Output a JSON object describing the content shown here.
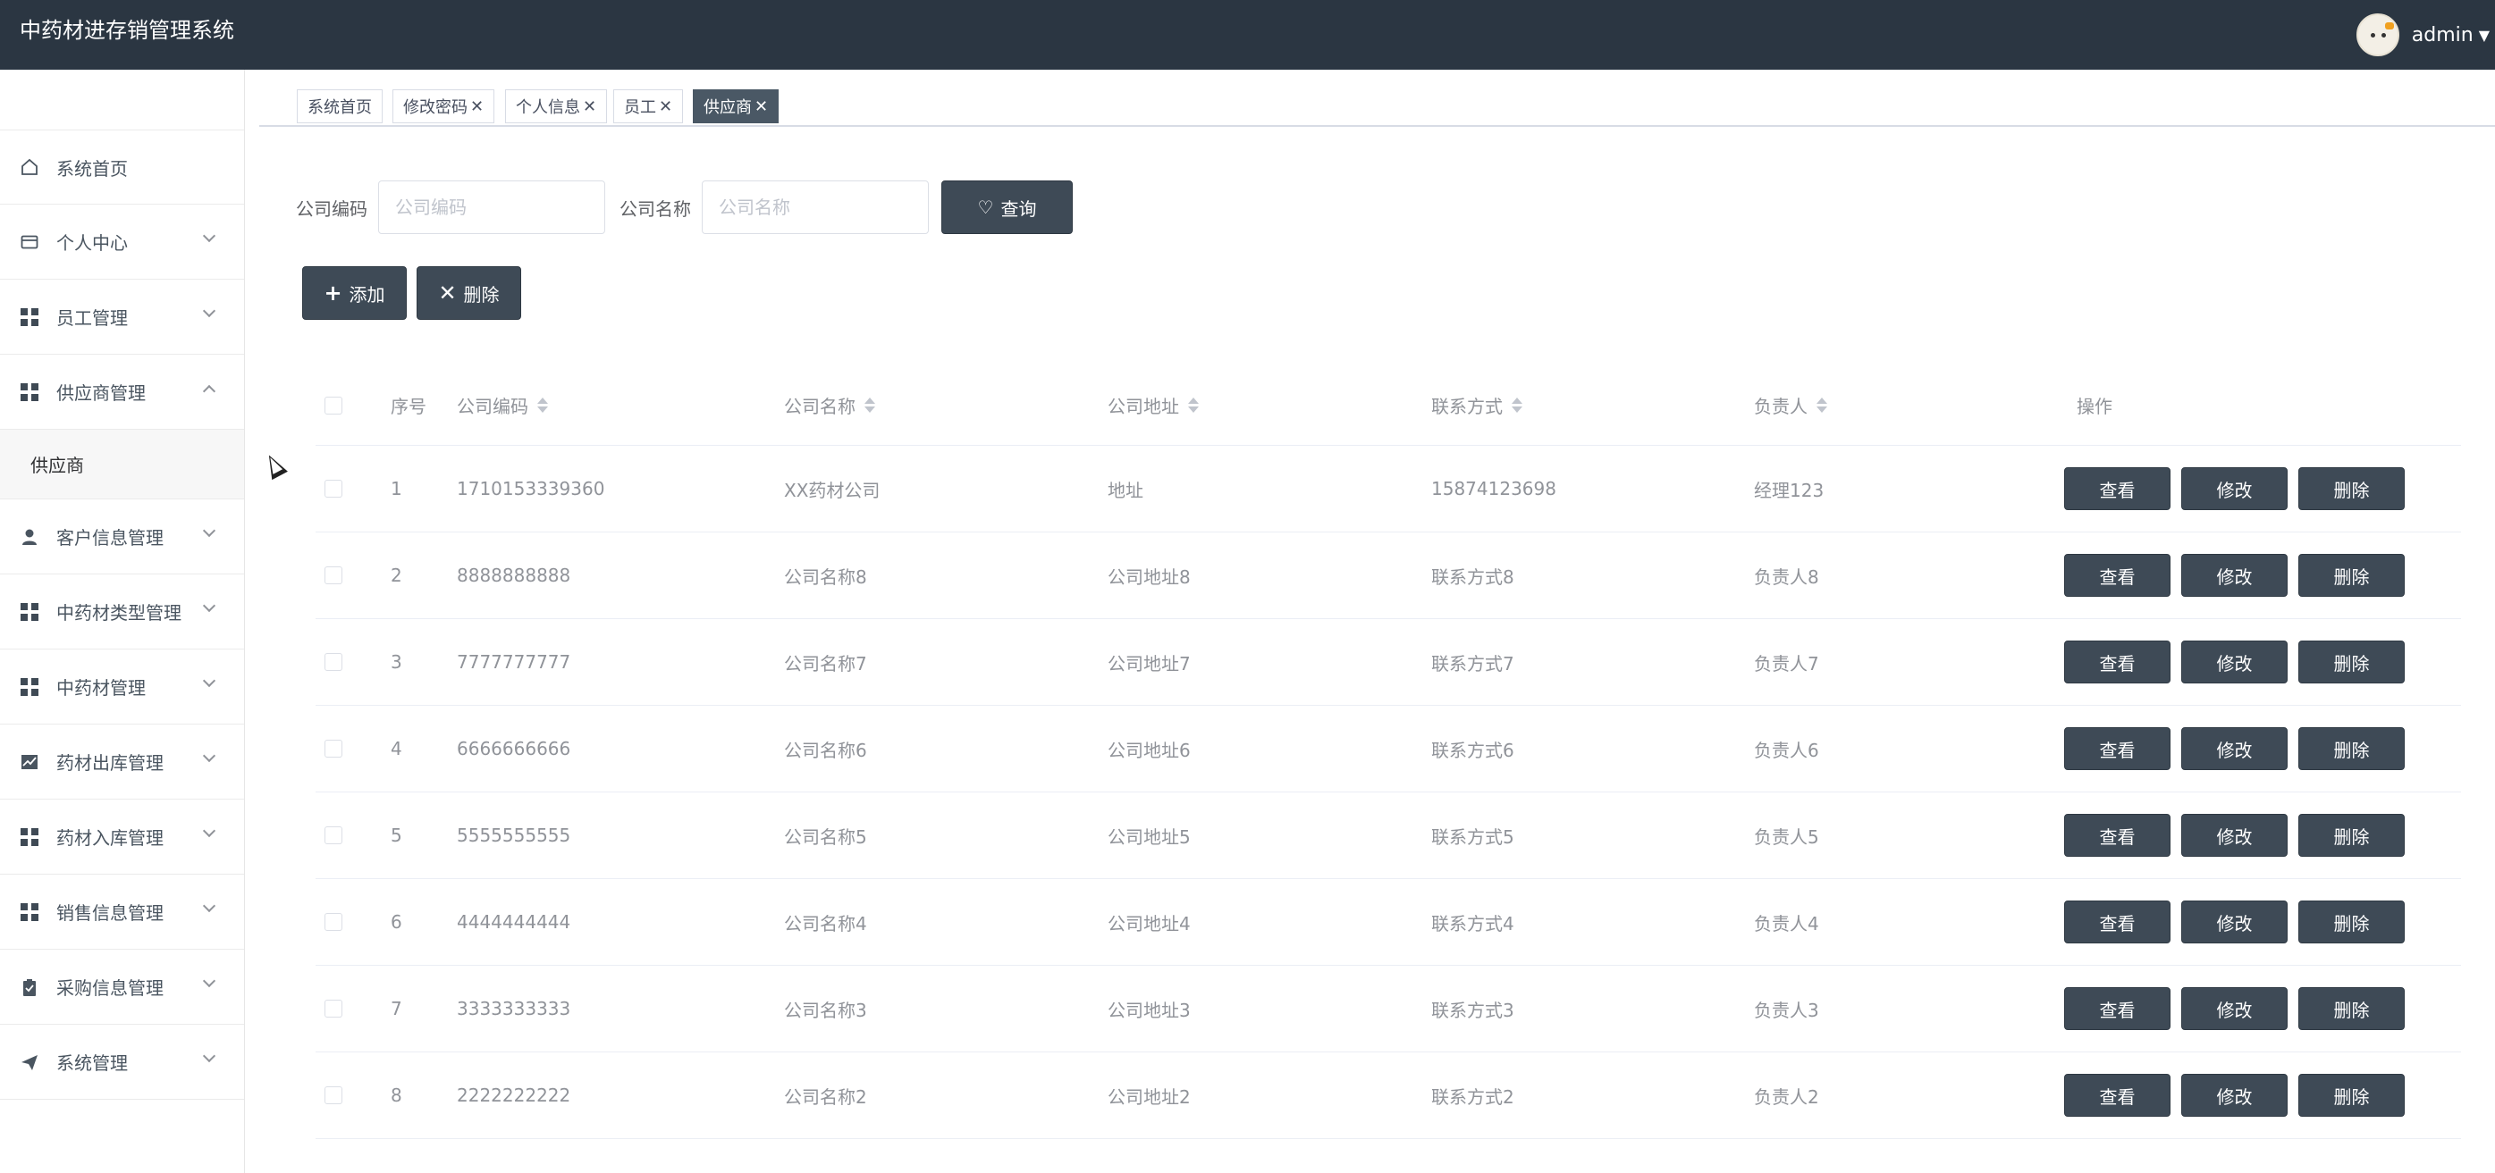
{
  "header": {
    "title": "中药材进存销管理系统",
    "user": "admin",
    "caret": "▼"
  },
  "sidebar": {
    "items": [
      {
        "label": "系统首页",
        "icon": "home-icon",
        "expandable": false
      },
      {
        "label": "个人中心",
        "icon": "card-icon",
        "expandable": true
      },
      {
        "label": "员工管理",
        "icon": "grid-icon",
        "expandable": true
      },
      {
        "label": "供应商管理",
        "icon": "grid-icon",
        "expandable": true,
        "expanded": true
      },
      {
        "label": "客户信息管理",
        "icon": "user-icon",
        "expandable": true
      },
      {
        "label": "中药材类型管理",
        "icon": "grid-icon",
        "expandable": true
      },
      {
        "label": "中药材管理",
        "icon": "grid-icon",
        "expandable": true
      },
      {
        "label": "药材出库管理",
        "icon": "chart-icon",
        "expandable": true
      },
      {
        "label": "药材入库管理",
        "icon": "grid-icon",
        "expandable": true
      },
      {
        "label": "销售信息管理",
        "icon": "grid-icon",
        "expandable": true
      },
      {
        "label": "采购信息管理",
        "icon": "clipboard-icon",
        "expandable": true
      },
      {
        "label": "系统管理",
        "icon": "send-icon",
        "expandable": true
      }
    ],
    "submenu": {
      "label": "供应商"
    }
  },
  "tabs": [
    {
      "label": "系统首页",
      "closable": false
    },
    {
      "label": "修改密码",
      "closable": true
    },
    {
      "label": "个人信息",
      "closable": true
    },
    {
      "label": "员工",
      "closable": true
    },
    {
      "label": "供应商",
      "closable": true,
      "active": true
    }
  ],
  "tab_close": "✕",
  "search": {
    "code_label": "公司编码",
    "code_placeholder": "公司编码",
    "name_label": "公司名称",
    "name_placeholder": "公司名称",
    "query_label": "查询"
  },
  "actions": {
    "add_label": "添加",
    "delete_label": "删除"
  },
  "table": {
    "columns": [
      "序号",
      "公司编码",
      "公司名称",
      "公司地址",
      "联系方式",
      "负责人",
      "操作"
    ],
    "op_labels": [
      "查看",
      "修改",
      "删除"
    ],
    "rows": [
      [
        "1",
        "1710153339360",
        "XX药材公司",
        "地址",
        "15874123698",
        "经理123"
      ],
      [
        "2",
        "8888888888",
        "公司名称8",
        "公司地址8",
        "联系方式8",
        "负责人8"
      ],
      [
        "3",
        "7777777777",
        "公司名称7",
        "公司地址7",
        "联系方式7",
        "负责人7"
      ],
      [
        "4",
        "6666666666",
        "公司名称6",
        "公司地址6",
        "联系方式6",
        "负责人6"
      ],
      [
        "5",
        "5555555555",
        "公司名称5",
        "公司地址5",
        "联系方式5",
        "负责人5"
      ],
      [
        "6",
        "4444444444",
        "公司名称4",
        "公司地址4",
        "联系方式4",
        "负责人4"
      ],
      [
        "7",
        "3333333333",
        "公司名称3",
        "公司地址3",
        "联系方式3",
        "负责人3"
      ],
      [
        "8",
        "2222222222",
        "公司名称2",
        "公司地址2",
        "联系方式2",
        "负责人2"
      ]
    ]
  }
}
